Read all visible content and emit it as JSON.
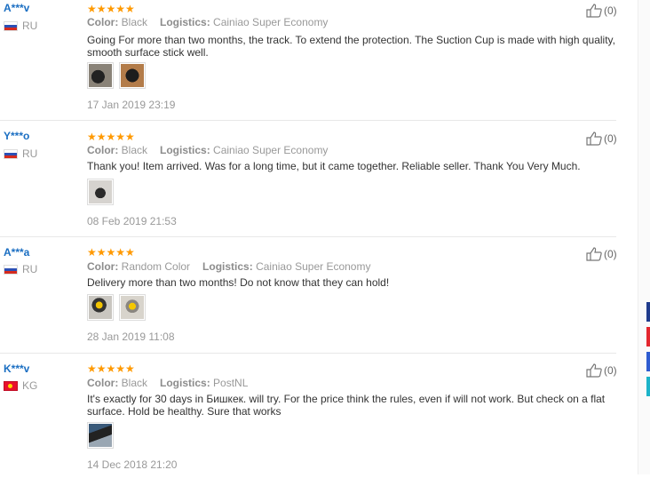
{
  "labels": {
    "color": "Color:",
    "logistics": "Logistics:"
  },
  "reviews": [
    {
      "user": "A***v",
      "country": "RU",
      "flag": "ru",
      "stars": "★★★★★",
      "color": "Black",
      "logistics": "Cainiao Super Economy",
      "text": "Going For more than two months, the track. To extend the protection. The Suction Cup is made with high quality, smooth surface stick well.",
      "photo_count": 2,
      "date": "17 Jan 2019 23:19",
      "likes": "(0)"
    },
    {
      "user": "Y***o",
      "country": "RU",
      "flag": "ru",
      "stars": "★★★★★",
      "color": "Black",
      "logistics": "Cainiao Super Economy",
      "text": "Thank you! Item arrived. Was for a long time, but it came together. Reliable seller. Thank You Very Much.",
      "photo_count": 1,
      "date": "08 Feb 2019 21:53",
      "likes": "(0)"
    },
    {
      "user": "A***a",
      "country": "RU",
      "flag": "ru",
      "stars": "★★★★★",
      "color": "Random Color",
      "logistics": "Cainiao Super Economy",
      "text": "Delivery more than two months! Do not know that they can hold!",
      "photo_count": 2,
      "date": "28 Jan 2019 11:08",
      "likes": "(0)"
    },
    {
      "user": "K***v",
      "country": "KG",
      "flag": "kg",
      "stars": "★★★★★",
      "color": "Black",
      "logistics": "PostNL",
      "text": "It's exactly for 30 days in Бишкек. will try. For the price think the rules, even if will not work. But check on a flat surface. Hold be healthy. Sure that works",
      "photo_count": 1,
      "date": "14 Dec 2018 21:20",
      "likes": "(0)"
    }
  ],
  "colors": {
    "username": "#1a6ec2",
    "star": "#ff9900",
    "muted": "#999999"
  }
}
